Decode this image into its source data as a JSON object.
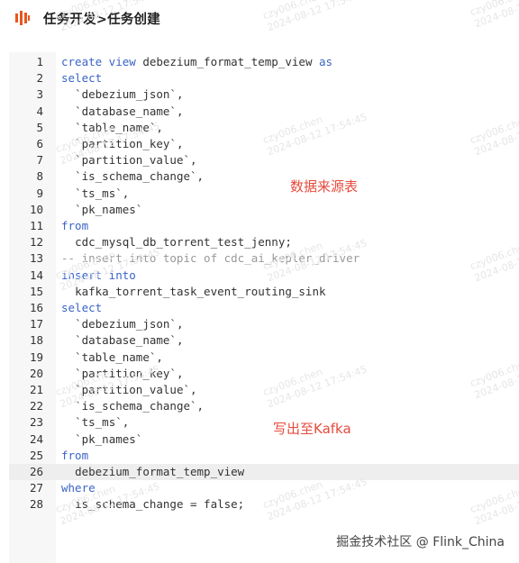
{
  "header": {
    "title": "任务开发>任务创建",
    "logo_icon": "brand-logo-icon"
  },
  "editor": {
    "active_line": 26,
    "lines": [
      {
        "n": "1",
        "indent": "",
        "tokens": [
          {
            "t": "create view",
            "k": "kw"
          },
          {
            "t": " debezium_format_temp_view ",
            "k": ""
          },
          {
            "t": "as",
            "k": "kw"
          }
        ]
      },
      {
        "n": "2",
        "indent": "",
        "tokens": [
          {
            "t": "select",
            "k": "kw"
          }
        ]
      },
      {
        "n": "3",
        "indent": "  ",
        "tokens": [
          {
            "t": "`debezium_json`,",
            "k": ""
          }
        ]
      },
      {
        "n": "4",
        "indent": "  ",
        "tokens": [
          {
            "t": "`database_name`,",
            "k": ""
          }
        ]
      },
      {
        "n": "5",
        "indent": "  ",
        "tokens": [
          {
            "t": "`table_name`,",
            "k": ""
          }
        ]
      },
      {
        "n": "6",
        "indent": "  ",
        "tokens": [
          {
            "t": "`partition_key`,",
            "k": ""
          }
        ]
      },
      {
        "n": "7",
        "indent": "  ",
        "tokens": [
          {
            "t": "`partition_value`,",
            "k": ""
          }
        ]
      },
      {
        "n": "8",
        "indent": "  ",
        "tokens": [
          {
            "t": "`is_schema_change`,",
            "k": ""
          }
        ]
      },
      {
        "n": "9",
        "indent": "  ",
        "tokens": [
          {
            "t": "`ts_ms`,",
            "k": ""
          }
        ]
      },
      {
        "n": "10",
        "indent": "  ",
        "tokens": [
          {
            "t": "`pk_names`",
            "k": ""
          }
        ]
      },
      {
        "n": "11",
        "indent": "",
        "tokens": [
          {
            "t": "from",
            "k": "kw"
          }
        ]
      },
      {
        "n": "12",
        "indent": "  ",
        "tokens": [
          {
            "t": "cdc_mysql_db_torrent_test_jenny;",
            "k": ""
          }
        ]
      },
      {
        "n": "13",
        "indent": "",
        "tokens": [
          {
            "t": "-- insert into topic of cdc_ai_kepler_driver",
            "k": "cm"
          }
        ]
      },
      {
        "n": "14",
        "indent": "",
        "tokens": [
          {
            "t": "insert into",
            "k": "kw"
          }
        ]
      },
      {
        "n": "15",
        "indent": "  ",
        "tokens": [
          {
            "t": "kafka_torrent_task_event_routing_sink",
            "k": ""
          }
        ]
      },
      {
        "n": "16",
        "indent": "",
        "tokens": [
          {
            "t": "select",
            "k": "kw"
          }
        ]
      },
      {
        "n": "17",
        "indent": "  ",
        "tokens": [
          {
            "t": "`debezium_json`,",
            "k": ""
          }
        ]
      },
      {
        "n": "18",
        "indent": "  ",
        "tokens": [
          {
            "t": "`database_name`,",
            "k": ""
          }
        ]
      },
      {
        "n": "19",
        "indent": "  ",
        "tokens": [
          {
            "t": "`table_name`,",
            "k": ""
          }
        ]
      },
      {
        "n": "20",
        "indent": "  ",
        "tokens": [
          {
            "t": "`partition_key`,",
            "k": ""
          }
        ]
      },
      {
        "n": "21",
        "indent": "  ",
        "tokens": [
          {
            "t": "`partition_value`,",
            "k": ""
          }
        ]
      },
      {
        "n": "22",
        "indent": "  ",
        "tokens": [
          {
            "t": "`is_schema_change`,",
            "k": ""
          }
        ]
      },
      {
        "n": "23",
        "indent": "  ",
        "tokens": [
          {
            "t": "`ts_ms`,",
            "k": ""
          }
        ]
      },
      {
        "n": "24",
        "indent": "  ",
        "tokens": [
          {
            "t": "`pk_names`",
            "k": ""
          }
        ]
      },
      {
        "n": "25",
        "indent": "",
        "tokens": [
          {
            "t": "from",
            "k": "kw"
          }
        ]
      },
      {
        "n": "26",
        "indent": "  ",
        "tokens": [
          {
            "t": "debezium_format_temp_view",
            "k": ""
          }
        ]
      },
      {
        "n": "27",
        "indent": "",
        "tokens": [
          {
            "t": "where",
            "k": "kw"
          }
        ]
      },
      {
        "n": "28",
        "indent": "  ",
        "tokens": [
          {
            "t": "is_schema_change = false;",
            "k": ""
          }
        ]
      }
    ]
  },
  "annotations": {
    "source_table": "数据来源表",
    "write_kafka": "写出至Kafka"
  },
  "watermark": {
    "user": "czy006.chen",
    "timestamp": "2024-08-12 17:54:45"
  },
  "footer": {
    "credit": "掘金技术社区 @ Flink_China"
  },
  "colors": {
    "keyword": "#3a64c8",
    "comment": "#999999",
    "annotation": "#e64b3c",
    "logo": "#e8561e",
    "active_line_bg": "#eeeeee"
  }
}
